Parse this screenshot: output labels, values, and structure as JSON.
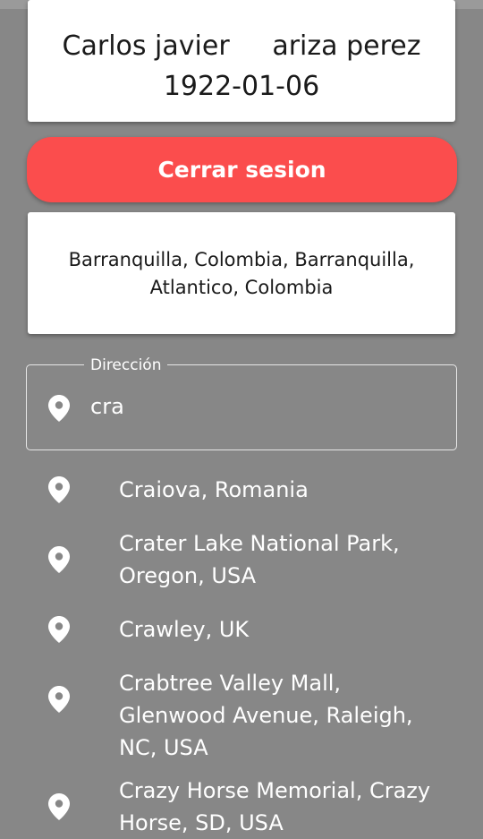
{
  "profile": {
    "first_name": "Carlos javier",
    "last_name": "ariza perez",
    "birth_date": "1922-01-06"
  },
  "logout": {
    "label": "Cerrar sesion",
    "color": "#fb4d4d"
  },
  "current_address": {
    "text": "Barranquilla, Colombia, Barranquilla, Atlantico, Colombia"
  },
  "address_field": {
    "label": "Dirección",
    "value": "cra",
    "icon": "location-pin-icon"
  },
  "suggestions": [
    {
      "text": "Craiova, Romania",
      "icon": "location-pin-icon"
    },
    {
      "text": "Crater Lake National Park, Oregon, USA",
      "icon": "location-pin-icon"
    },
    {
      "text": "Crawley, UK",
      "icon": "location-pin-icon"
    },
    {
      "text": "Crabtree Valley Mall, Glenwood Avenue, Raleigh, NC, USA",
      "icon": "location-pin-icon"
    },
    {
      "text": "Crazy Horse Memorial, Crazy Horse, SD, USA",
      "icon": "location-pin-icon"
    }
  ],
  "colors": {
    "background": "#878787",
    "card": "#ffffff",
    "text_on_bg": "#ffffff"
  }
}
